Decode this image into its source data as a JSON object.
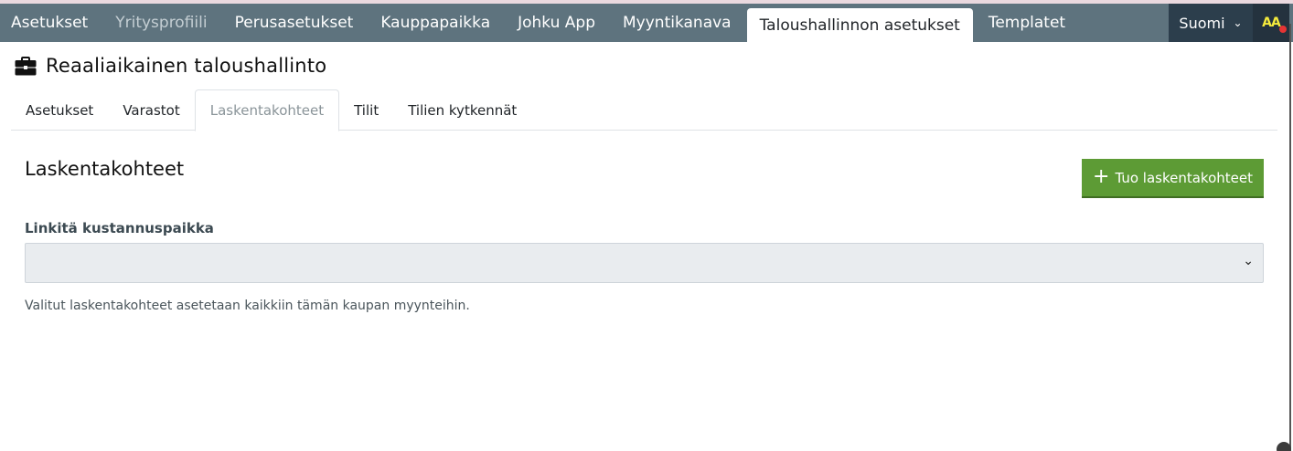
{
  "topnav": {
    "items": [
      {
        "label": "Asetukset"
      },
      {
        "label": "Yritysprofiili"
      },
      {
        "label": "Perusasetukset"
      },
      {
        "label": "Kauppapaikka"
      },
      {
        "label": "Johku App"
      },
      {
        "label": "Myyntikanava"
      },
      {
        "label": "Taloushallinnon asetukset"
      },
      {
        "label": "Templatet"
      }
    ],
    "language": "Suomi",
    "user_initials": "AA",
    "chevron_icon": "chevron-down-icon"
  },
  "page": {
    "title": "Reaaliaikainen taloushallinto",
    "title_icon": "briefcase-icon"
  },
  "tabs": [
    {
      "label": "Asetukset"
    },
    {
      "label": "Varastot"
    },
    {
      "label": "Laskentakohteet"
    },
    {
      "label": "Tilit"
    },
    {
      "label": "Tilien kytkennät"
    }
  ],
  "section": {
    "title": "Laskentakohteet",
    "add_button_label": "Tuo laskentakohteet",
    "field_label": "Linkitä kustannuspaikka",
    "select_value": "",
    "help_text": "Valitut laskentakohteet asetetaan kaikkiin tämän kaupan myynteihin."
  },
  "colors": {
    "topbar": "#5e737e",
    "primary_button": "#5d9b35",
    "language_bg": "#2c3e4c",
    "notification_dot": "#e53434",
    "initials": "#f5ea3c"
  }
}
